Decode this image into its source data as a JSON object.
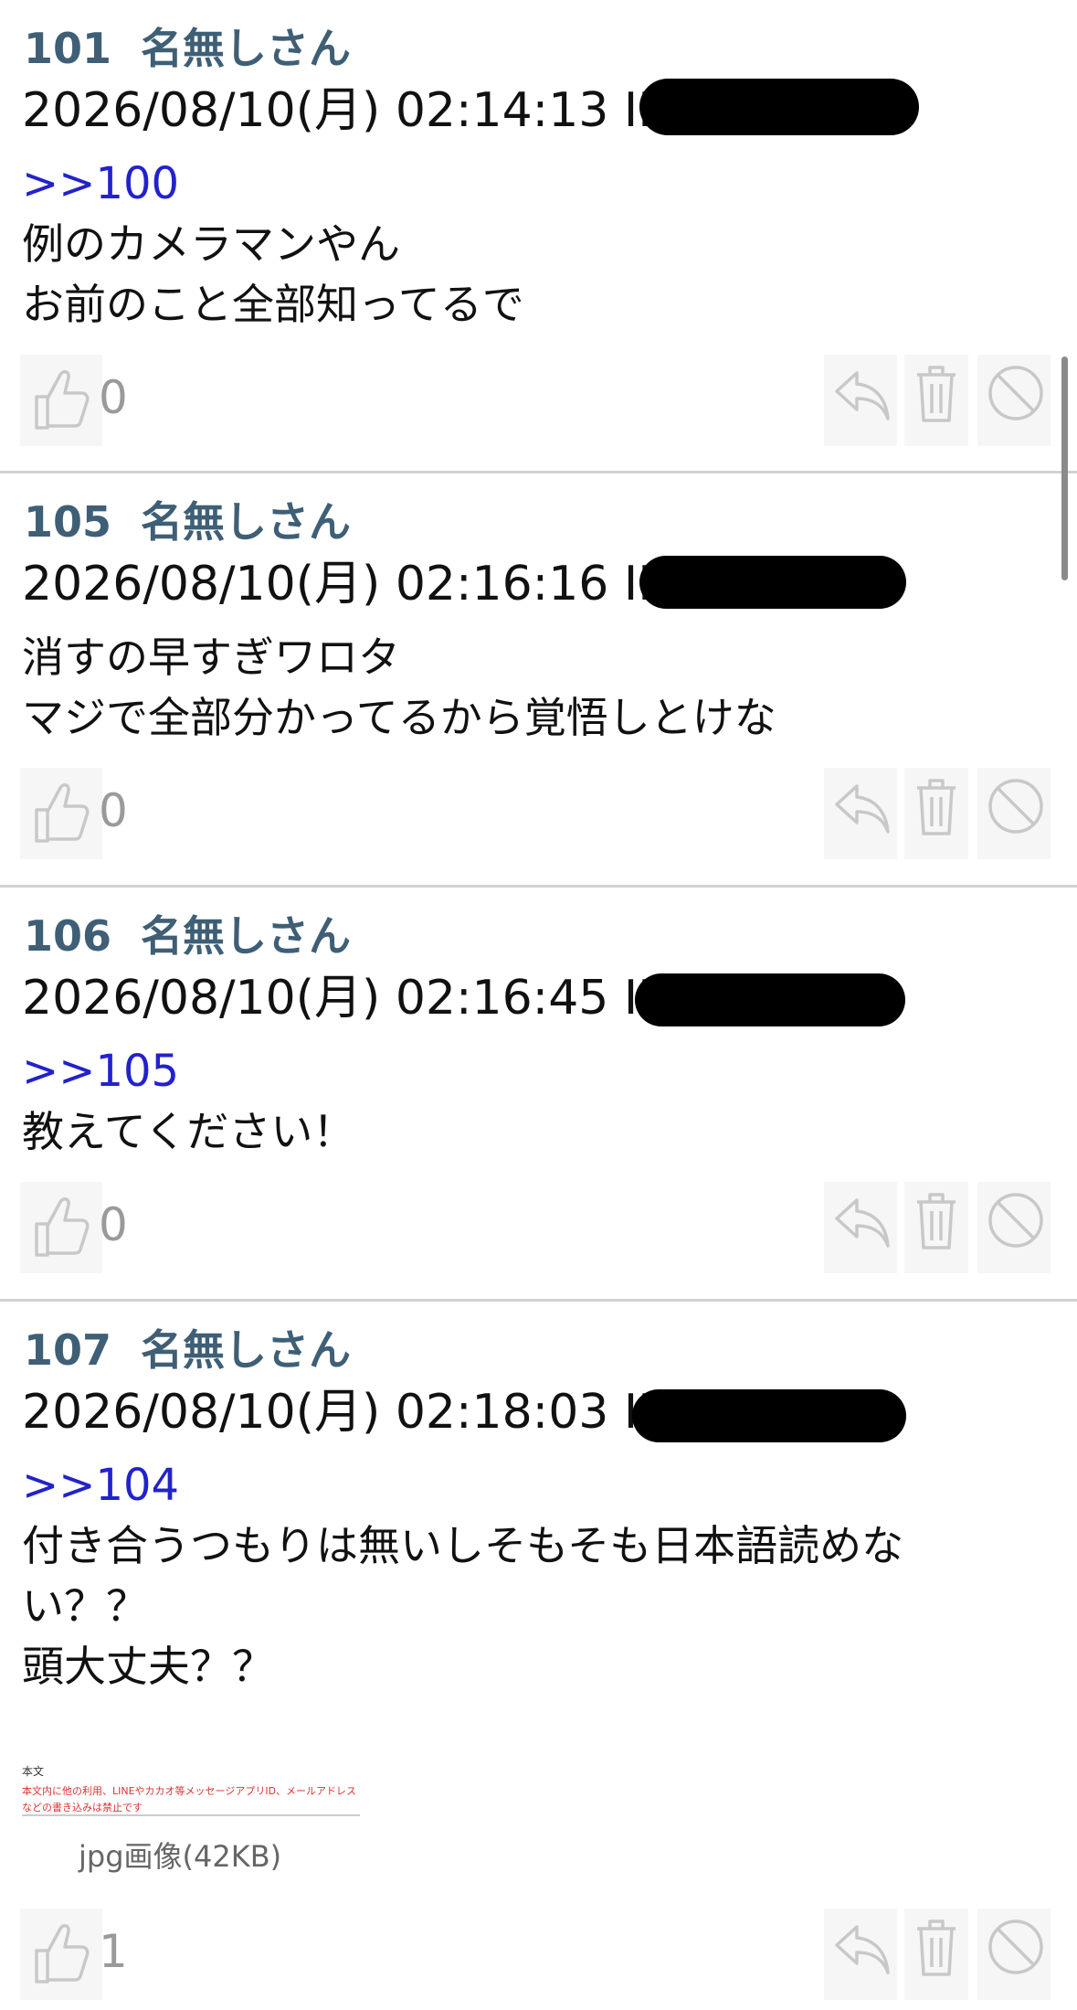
{
  "posts": [
    {
      "number": "101",
      "name": "名無しさん",
      "datetime": "2026/08/10(月) 02:14:13 ID:",
      "anchor": ">>100",
      "lines": [
        "例のカメラマンやん",
        "お前のこと全部知ってるで"
      ],
      "likes": "0"
    },
    {
      "number": "105",
      "name": "名無しさん",
      "datetime": "2026/08/10(月) 02:16:16 ID:",
      "anchor": "",
      "lines": [
        "消すの早すぎワロタ",
        "マジで全部分かってるから覚悟しとけな"
      ],
      "likes": "0"
    },
    {
      "number": "106",
      "name": "名無しさん",
      "datetime": "2026/08/10(月) 02:16:45 ID",
      "anchor": ">>105",
      "lines": [
        "教えてください！"
      ],
      "likes": "0"
    },
    {
      "number": "107",
      "name": "名無しさん",
      "datetime": "2026/08/10(月) 02:18:03 ID",
      "anchor": ">>104",
      "lines": [
        "付き合うつもりは無いしそもそも日本語読めな",
        "い？？",
        "頭大丈夫？？"
      ],
      "likes": "1",
      "attachment": {
        "label": "jpg画像(42KB)",
        "thumb_heading": "本文",
        "thumb_line1": "本文内に他の利用、LINEやカカオ等メッセージアプリID、メールアドレス",
        "thumb_line2": "などの書き込みは禁止です"
      }
    }
  ],
  "icons": {
    "like": "thumbs-up-icon",
    "reply": "reply-icon",
    "delete": "trash-icon",
    "block": "block-icon"
  },
  "colors": {
    "header": "#3e5f76",
    "anchor": "#2222cc",
    "icon": "#c8c8c8",
    "divider": "#d2d2d2"
  }
}
